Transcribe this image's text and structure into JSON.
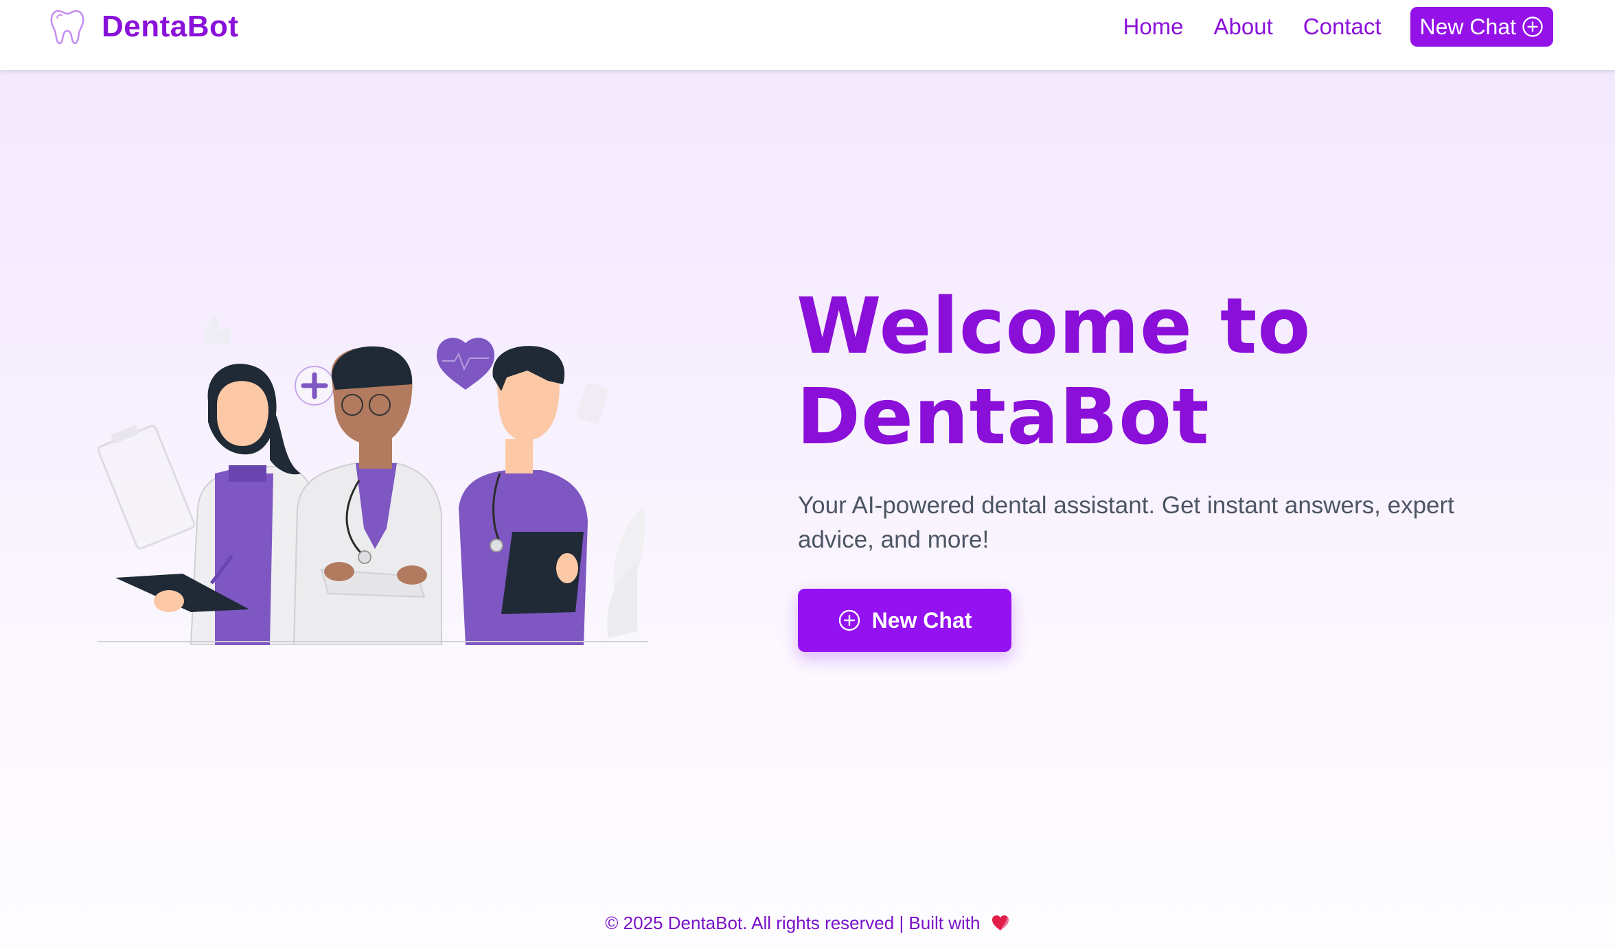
{
  "header": {
    "brand_name": "DentaBot",
    "brand_icon": "tooth-icon",
    "nav": {
      "home": "Home",
      "about": "About",
      "contact": "Contact",
      "new_chat": "New Chat"
    }
  },
  "hero": {
    "title_line1": "Welcome to",
    "title_line2": "DentaBot",
    "subtitle": "Your AI-powered dental assistant. Get instant answers, expert advice, and more!",
    "button_label": "New Chat",
    "illustration": "medical-team-illustration"
  },
  "footer": {
    "text": "© 2025 DentaBot. All rights reserved | Built with",
    "icon": "heart-icon"
  },
  "colors": {
    "brand": "#8a11d9",
    "button": "#9411f2",
    "subtitle_text": "#4b5563",
    "heart": "#e11d48"
  }
}
